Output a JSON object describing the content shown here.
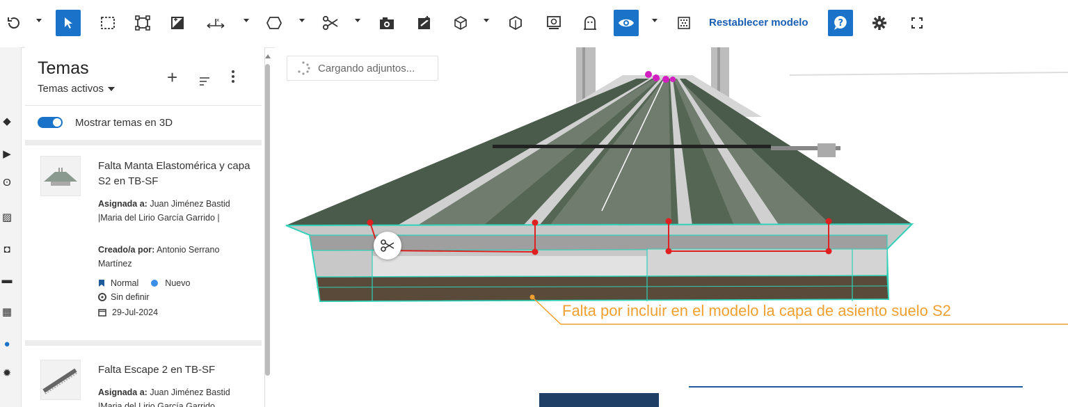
{
  "toolbar": {
    "reset_label": "Restablecer modelo",
    "icons": [
      "rotate-icon",
      "select-pointer-icon",
      "box-select-icon",
      "fit-icon",
      "clip-box-icon",
      "measure-icon",
      "shape-icon",
      "scissor-icon",
      "camera-icon",
      "issue-icon",
      "cube-icon",
      "cube-outline-icon",
      "monitor-icon",
      "ghost-icon",
      "eye-icon",
      "pattern-icon",
      "help-icon",
      "gear-icon",
      "fullscreen-icon"
    ],
    "accent_color": "#1a73c9"
  },
  "panel": {
    "title": "Temas",
    "filter_label": "Temas activos",
    "toggle_label": "Mostrar temas en 3D",
    "toggle_on": true,
    "issues": [
      {
        "title": "Falta Manta Elastomérica y capa S2 en TB-SF",
        "assigned_label": "Asignada a:",
        "assigned_value": "Juan Jiménez Bastid |Maria del Lirio García Garrido |",
        "created_label": "Creado/a por:",
        "created_value": "Antonio Serrano Martínez",
        "priority": "Normal",
        "status": "Nuevo",
        "type": "Sin definir",
        "date": "29-Jul-2024"
      },
      {
        "title": "Falta Escape 2 en TB-SF",
        "assigned_label": "Asignada a:",
        "assigned_value": "Juan Jiménez Bastid |Maria del Lirio García Garrido"
      }
    ]
  },
  "viewport": {
    "loading_text": "Cargando adjuntos...",
    "annotation_text": "Falta por incluir en el modelo la capa de asiento suelo S2",
    "annotation_color": "#f0a030",
    "outline_color": "#2fd1b8",
    "section_color": "#e02020"
  }
}
